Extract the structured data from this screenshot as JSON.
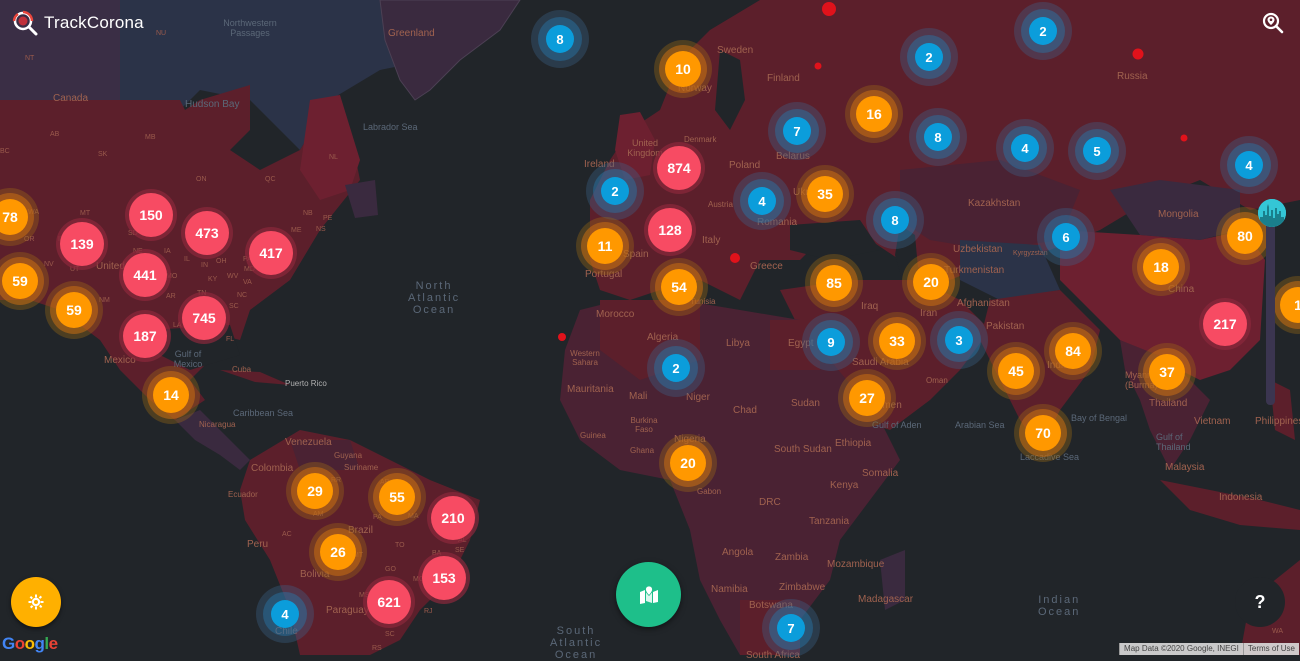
{
  "app": {
    "title": "TrackCorona",
    "logo_icon": "virus-magnifier-icon"
  },
  "controls": {
    "search_icon": "map-search-icon",
    "settings_icon": "gear-icon",
    "layers_icon": "map-marker-icon",
    "help_label": "?",
    "timeline_icon": "city-skyline-icon"
  },
  "colors": {
    "severity_high": "#f74b63",
    "severity_medium": "#ff9800",
    "severity_low": "#0b9ddb",
    "land_affected": "#5c1f2b",
    "land_other": "#3a2a3f",
    "ocean": "#212529",
    "settings_button": "#ffb000",
    "layers_button": "#1ebf8a"
  },
  "attribution": {
    "map_data": "Map Data ©2020 Google, INEGI",
    "terms": "Terms of Use",
    "google": [
      "G",
      "o",
      "o",
      "g",
      "l",
      "e"
    ]
  },
  "oceans": [
    {
      "name": "North Atlantic Ocean",
      "lines": [
        "North",
        "Atlantic",
        "Ocean"
      ]
    },
    {
      "name": "South Atlantic Ocean",
      "lines": [
        "South",
        "Atlantic",
        "Ocean"
      ]
    },
    {
      "name": "Indian Ocean",
      "lines": [
        "Indian",
        "Ocean"
      ]
    }
  ],
  "seas": [
    "Labrador Sea",
    "Hudson Bay",
    "Northwestern Passages",
    "Gulf of Mexico",
    "Caribbean Sea",
    "Arabian Sea",
    "Bay of Bengal",
    "Laccadive Sea",
    "Gulf of Aden",
    "Gulf of Thailand"
  ],
  "countries": [
    "Greenland",
    "Canada",
    "United States",
    "Mexico",
    "Cuba",
    "Puerto Rico",
    "Nicaragua",
    "Venezuela",
    "Guyana",
    "Suriname",
    "Colombia",
    "Ecuador",
    "Peru",
    "Brazil",
    "Bolivia",
    "Paraguay",
    "Chile",
    "Ireland",
    "United Kingdom",
    "Norway",
    "Sweden",
    "Finland",
    "Denmark",
    "Poland",
    "Belarus",
    "Ukraine",
    "Romania",
    "Austria",
    "Italy",
    "Greece",
    "Spain",
    "Portugal",
    "Morocco",
    "Algeria",
    "Tunisia",
    "Libya",
    "Egypt",
    "Western Sahara",
    "Mauritania",
    "Mali",
    "Niger",
    "Chad",
    "Sudan",
    "South Sudan",
    "Ethiopia",
    "Somalia",
    "Kenya",
    "Tanzania",
    "Burkina Faso",
    "Guinea",
    "Ghana",
    "Nigeria",
    "Gabon",
    "DRC",
    "Angola",
    "Zambia",
    "Mozambique",
    "Zimbabwe",
    "Namibia",
    "Botswana",
    "Madagascar",
    "South Africa",
    "Russia",
    "Kazakhstan",
    "Uzbekistan",
    "Kyrgyzstan",
    "Turkmenistan",
    "Afghanistan",
    "Pakistan",
    "Iran",
    "Iraq",
    "Saudi Arabia",
    "Oman",
    "Yemen",
    "India",
    "China",
    "Mongolia",
    "Myanmar (Burma)",
    "Thailand",
    "Vietnam",
    "Malaysia",
    "Indonesia",
    "Philippines"
  ],
  "states": [
    "NU",
    "NT",
    "AB",
    "SK",
    "MB",
    "ON",
    "QC",
    "BC",
    "NL",
    "NB",
    "PE",
    "NS",
    "WA",
    "OR",
    "MT",
    "ID",
    "NV",
    "UT",
    "NM",
    "SD",
    "NE",
    "IA",
    "IL",
    "IN",
    "OH",
    "MO",
    "AR",
    "KY",
    "WV",
    "VA",
    "PA",
    "MD",
    "NC",
    "SC",
    "TN",
    "LA",
    "FL",
    "ME",
    "AM",
    "PA",
    "MA",
    "AP",
    "RR",
    "AC",
    "TO",
    "MT",
    "GO",
    "MG",
    "MS",
    "SC",
    "RS",
    "BA",
    "PI",
    "AL",
    "SE",
    "RJ",
    "WA"
  ],
  "clusters": [
    {
      "id": "iceland",
      "count": "8",
      "level": "blue"
    },
    {
      "id": "norway",
      "count": "10",
      "level": "orange"
    },
    {
      "id": "russia-nw",
      "count": "2",
      "level": "blue"
    },
    {
      "id": "russia-n",
      "count": "2",
      "level": "blue"
    },
    {
      "id": "belarus",
      "count": "7",
      "level": "blue"
    },
    {
      "id": "russia-w",
      "count": "16",
      "level": "orange"
    },
    {
      "id": "russia-c",
      "count": "8",
      "level": "blue"
    },
    {
      "id": "russia-ural",
      "count": "4",
      "level": "blue"
    },
    {
      "id": "russia-siberia",
      "count": "5",
      "level": "blue"
    },
    {
      "id": "russia-east",
      "count": "4",
      "level": "blue"
    },
    {
      "id": "uk-benelux",
      "count": "874",
      "level": "red"
    },
    {
      "id": "ireland",
      "count": "2",
      "level": "blue"
    },
    {
      "id": "france",
      "count": "128",
      "level": "red"
    },
    {
      "id": "portugal",
      "count": "11",
      "level": "orange"
    },
    {
      "id": "romania",
      "count": "4",
      "level": "blue"
    },
    {
      "id": "ukraine",
      "count": "35",
      "level": "orange"
    },
    {
      "id": "caucasus",
      "count": "8",
      "level": "blue"
    },
    {
      "id": "kazakhstan-e",
      "count": "6",
      "level": "blue"
    },
    {
      "id": "china-ne",
      "count": "80",
      "level": "orange"
    },
    {
      "id": "china-w",
      "count": "18",
      "level": "orange"
    },
    {
      "id": "china-e",
      "count": "217",
      "level": "red"
    },
    {
      "id": "tunisia",
      "count": "54",
      "level": "orange"
    },
    {
      "id": "turkey",
      "count": "85",
      "level": "orange"
    },
    {
      "id": "iran-n",
      "count": "20",
      "level": "orange"
    },
    {
      "id": "egypt",
      "count": "9",
      "level": "blue"
    },
    {
      "id": "saudi",
      "count": "33",
      "level": "orange"
    },
    {
      "id": "pakistan",
      "count": "3",
      "level": "blue"
    },
    {
      "id": "india-w",
      "count": "45",
      "level": "orange"
    },
    {
      "id": "india-n",
      "count": "84",
      "level": "orange"
    },
    {
      "id": "thailand",
      "count": "37",
      "level": "orange"
    },
    {
      "id": "india-s",
      "count": "70",
      "level": "orange"
    },
    {
      "id": "algeria",
      "count": "2",
      "level": "blue"
    },
    {
      "id": "yemen",
      "count": "27",
      "level": "orange"
    },
    {
      "id": "nigeria",
      "count": "20",
      "level": "orange"
    },
    {
      "id": "south-africa",
      "count": "7",
      "level": "blue"
    },
    {
      "id": "us-wa",
      "count": "78",
      "level": "orange"
    },
    {
      "id": "us-ca-n",
      "count": "59",
      "level": "orange"
    },
    {
      "id": "us-ca-s",
      "count": "59",
      "level": "orange"
    },
    {
      "id": "us-mountain",
      "count": "139",
      "level": "red"
    },
    {
      "id": "us-north",
      "count": "150",
      "level": "red"
    },
    {
      "id": "us-midwest",
      "count": "441",
      "level": "red"
    },
    {
      "id": "us-great-lakes",
      "count": "473",
      "level": "red"
    },
    {
      "id": "us-northeast",
      "count": "417",
      "level": "red"
    },
    {
      "id": "us-south",
      "count": "187",
      "level": "red"
    },
    {
      "id": "us-southeast",
      "count": "745",
      "level": "red"
    },
    {
      "id": "guatemala",
      "count": "14",
      "level": "orange"
    },
    {
      "id": "brazil-am",
      "count": "29",
      "level": "orange"
    },
    {
      "id": "brazil-pa",
      "count": "55",
      "level": "orange"
    },
    {
      "id": "brazil-ne",
      "count": "210",
      "level": "red"
    },
    {
      "id": "brazil-mt",
      "count": "26",
      "level": "orange"
    },
    {
      "id": "brazil-ba",
      "count": "153",
      "level": "red"
    },
    {
      "id": "brazil-sp",
      "count": "621",
      "level": "red"
    },
    {
      "id": "chile",
      "count": "4",
      "level": "blue"
    },
    {
      "id": "east-asia-edge",
      "count": "1",
      "level": "orange"
    }
  ],
  "hotspots": [
    "kola",
    "karelia",
    "russia-central",
    "siberia",
    "italy-south",
    "canary-islands"
  ]
}
